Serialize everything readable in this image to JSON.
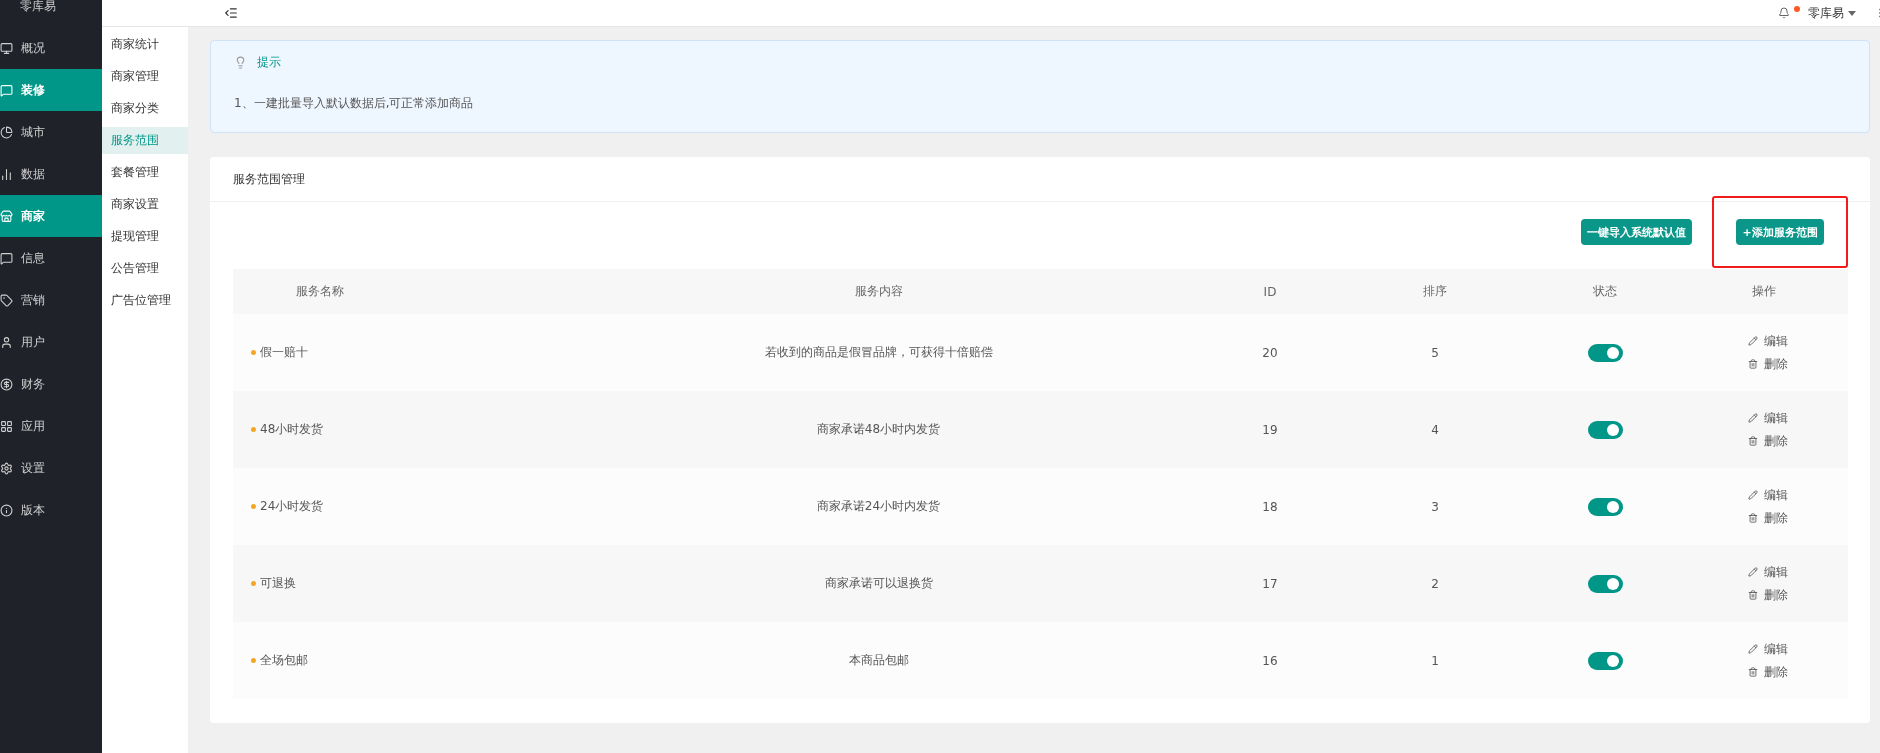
{
  "sidebar": {
    "logo": "零库易",
    "items": [
      {
        "label": "概况",
        "selected": false
      },
      {
        "label": "装修",
        "selected": true
      },
      {
        "label": "城市",
        "selected": false
      },
      {
        "label": "数据",
        "selected": false
      },
      {
        "label": "商家",
        "selected": true
      },
      {
        "label": "信息",
        "selected": false
      },
      {
        "label": "营销",
        "selected": false
      },
      {
        "label": "用户",
        "selected": false
      },
      {
        "label": "财务",
        "selected": false
      },
      {
        "label": "应用",
        "selected": false
      },
      {
        "label": "设置",
        "selected": false
      },
      {
        "label": "版本",
        "selected": false
      }
    ]
  },
  "submenu": [
    {
      "label": "商家统计",
      "selected": false
    },
    {
      "label": "商家管理",
      "selected": false
    },
    {
      "label": "商家分类",
      "selected": false
    },
    {
      "label": "服务范围",
      "selected": true
    },
    {
      "label": "套餐管理",
      "selected": false
    },
    {
      "label": "商家设置",
      "selected": false
    },
    {
      "label": "提现管理",
      "selected": false
    },
    {
      "label": "公告管理",
      "selected": false
    },
    {
      "label": "广告位管理",
      "selected": false
    }
  ],
  "topbar": {
    "user": "零库易",
    "has_notification": true
  },
  "tip": {
    "title": "提示",
    "text": "1、一建批量导入默认数据后,可正常添加商品"
  },
  "card": {
    "title": "服务范围管理",
    "buttons": [
      {
        "label": "一键导入系统默认值",
        "highlighted": false
      },
      {
        "label": "+添加服务范围",
        "highlighted": true
      }
    ],
    "table": {
      "columns": [
        "服务名称",
        "服务内容",
        "ID",
        "排序",
        "状态",
        "操作"
      ],
      "rows": [
        {
          "name": "假一赔十",
          "content": "若收到的商品是假冒品牌，可获得十倍赔偿",
          "id": "20",
          "sort": "5",
          "on": true,
          "edit": "编辑",
          "delete": "删除"
        },
        {
          "name": "48小时发货",
          "content": "商家承诺48小时内发货",
          "id": "19",
          "sort": "4",
          "on": true,
          "edit": "编辑",
          "delete": "删除"
        },
        {
          "name": "24小时发货",
          "content": "商家承诺24小时内发货",
          "id": "18",
          "sort": "3",
          "on": true,
          "edit": "编辑",
          "delete": "删除"
        },
        {
          "name": "可退换",
          "content": "商家承诺可以退换货",
          "id": "17",
          "sort": "2",
          "on": true,
          "edit": "编辑",
          "delete": "删除"
        },
        {
          "name": "全场包邮",
          "content": "本商品包邮",
          "id": "16",
          "sort": "1",
          "on": true,
          "edit": "编辑",
          "delete": "删除"
        }
      ]
    }
  }
}
